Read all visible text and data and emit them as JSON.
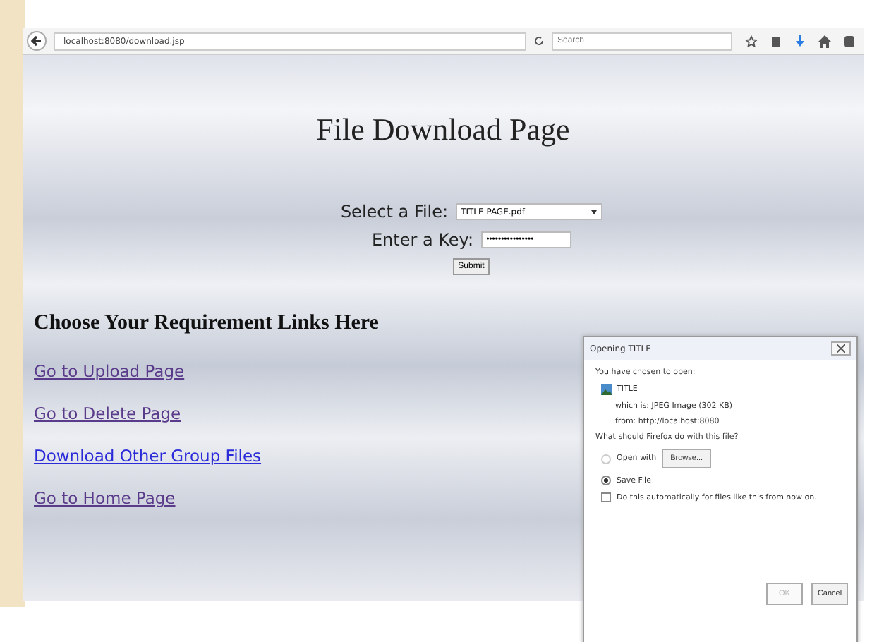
{
  "browser": {
    "url": "localhost:8080/download.jsp",
    "search": {
      "placeholder": "Search"
    }
  },
  "page": {
    "title": "File Download Page",
    "form": {
      "file_label": "Select a File:",
      "file_value": "TITLE PAGE.pdf",
      "key_label": "Enter a Key:",
      "key_value": "••••••••••••••••",
      "submit": "Submit"
    },
    "links_heading": "Choose Your Requirement Links Here",
    "links": [
      {
        "label": "Go to Upload Page",
        "visited": true
      },
      {
        "label": "Go to Delete Page",
        "visited": true
      },
      {
        "label": "Download Other Group Files",
        "visited": false
      },
      {
        "label": "Go to Home Page",
        "visited": true
      }
    ]
  },
  "dialog": {
    "title": "Opening TITLE",
    "intro": "You have chosen to open:",
    "file_name": "TITLE",
    "type_line": "which is: JPEG Image (302 KB)",
    "from_line": "from: http://localhost:8080",
    "question": "What should Firefox do with this file?",
    "options": [
      {
        "label": "Open with",
        "selected": false,
        "button": "Browse..."
      },
      {
        "label": "Save File",
        "selected": true
      }
    ],
    "auto": {
      "label": "Do this automatically for files like this from now on.",
      "checked": false
    },
    "buttons": [
      {
        "label": "OK",
        "disabled": true
      },
      {
        "label": "Cancel",
        "disabled": false
      }
    ]
  }
}
